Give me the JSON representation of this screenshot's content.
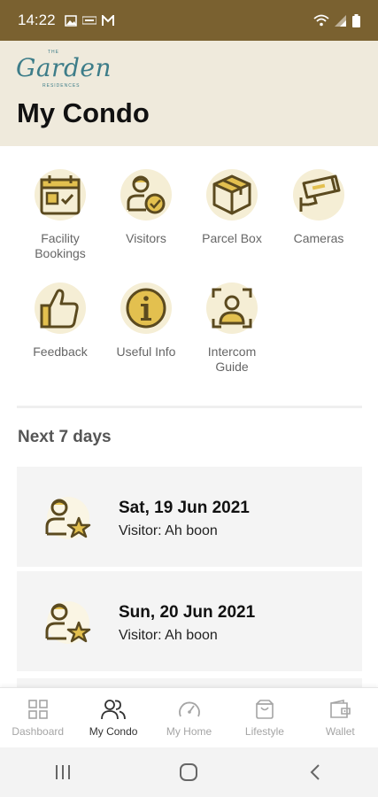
{
  "status_bar": {
    "time": "14:22",
    "right_icons": [
      "wifi-icon",
      "signal-icon",
      "battery-icon"
    ]
  },
  "header": {
    "logo": {
      "top": "THE",
      "script": "Garden",
      "bottom": "RESIDENCES"
    },
    "title": "My Condo"
  },
  "tiles": [
    {
      "label": "Facility\nBookings",
      "icon": "calendar-icon"
    },
    {
      "label": "Visitors",
      "icon": "visitor-check-icon"
    },
    {
      "label": "Parcel Box",
      "icon": "parcel-box-icon"
    },
    {
      "label": "Cameras",
      "icon": "cctv-camera-icon"
    },
    {
      "label": "Feedback",
      "icon": "thumbs-up-icon"
    },
    {
      "label": "Useful Info",
      "icon": "info-icon"
    },
    {
      "label": "Intercom\nGuide",
      "icon": "face-scan-icon"
    }
  ],
  "section_title": "Next 7 days",
  "events": [
    {
      "date": "Sat, 19 Jun 2021",
      "detail": "Visitor: Ah boon",
      "icon": "visitor-star-icon"
    },
    {
      "date": "Sun, 20 Jun 2021",
      "detail": "Visitor: Ah boon",
      "icon": "visitor-star-icon"
    }
  ],
  "bottom_nav": {
    "active": "My Condo",
    "items": [
      {
        "label": "Dashboard",
        "icon": "grid-icon"
      },
      {
        "label": "My Condo",
        "icon": "people-icon"
      },
      {
        "label": "My Home",
        "icon": "gauge-icon"
      },
      {
        "label": "Lifestyle",
        "icon": "shopping-bag-icon"
      },
      {
        "label": "Wallet",
        "icon": "wallet-icon"
      }
    ]
  },
  "colors": {
    "status_bar": "#7a6130",
    "header_bg": "#efeadc",
    "accent": "#e3c04f",
    "icon_stroke": "#5b4a1f",
    "card_bg": "#f4f4f4"
  }
}
